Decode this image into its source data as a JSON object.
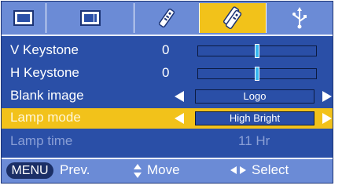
{
  "tabs": [
    {
      "name": "picture",
      "icon": "monitor-icon",
      "active": false
    },
    {
      "name": "screen",
      "icon": "screen-icon",
      "active": false
    },
    {
      "name": "remote",
      "icon": "remote-icon",
      "active": false
    },
    {
      "name": "remote-alt",
      "icon": "remote-double-icon",
      "active": true
    },
    {
      "name": "usb",
      "icon": "usb-icon",
      "active": false
    }
  ],
  "menu": {
    "v_keystone": {
      "label": "V Keystone",
      "value": "0",
      "level": 0.5
    },
    "h_keystone": {
      "label": "H Keystone",
      "value": "0",
      "level": 0.5
    },
    "blank_image": {
      "label": "Blank image",
      "value": "Logo"
    },
    "lamp_mode": {
      "label": "Lamp mode",
      "value": "High Bright"
    },
    "lamp_time": {
      "label": "Lamp time",
      "value": "11 Hr"
    }
  },
  "footer": {
    "menu_key": "MENU",
    "prev_label": "Prev.",
    "move_label": "Move",
    "select_label": "Select"
  },
  "colors": {
    "background": "#2a4fa7",
    "bar": "#6b8bd6",
    "highlight": "#f2c21a",
    "slider_thumb": "#35b6f0"
  }
}
